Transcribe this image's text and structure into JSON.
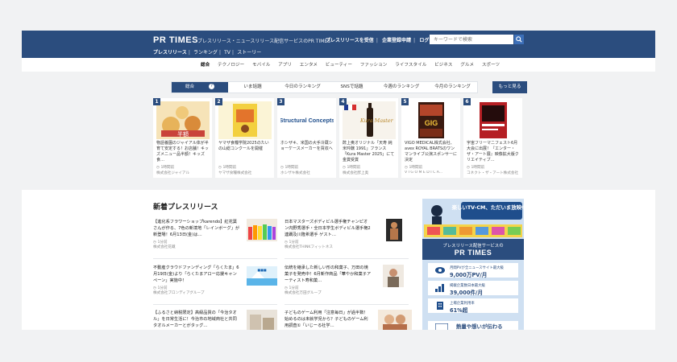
{
  "header": {
    "logo": "PR TIMES",
    "tagline": "プレスリリース・ニュースリリース配信サービスのPR TIMES",
    "links": [
      "プレスリリースを受信",
      "企業登録申請",
      "ログイン"
    ],
    "search_placeholder": "キーワードで検索",
    "subnav": [
      "プレスリリース",
      "ランキング",
      "TV",
      "ストーリー"
    ]
  },
  "category_nav": [
    "総合",
    "テクノロジー",
    "モバイル",
    "アプリ",
    "エンタメ",
    "ビューティー",
    "ファッション",
    "ライフスタイル",
    "ビジネス",
    "グルメ",
    "スポーツ"
  ],
  "ranking": {
    "tabs": [
      {
        "label": "総合",
        "badge": "?"
      },
      {
        "label": "いま話題"
      },
      {
        "label": "今日のランキング"
      },
      {
        "label": "SNSで話題"
      },
      {
        "label": "今週のランキング"
      },
      {
        "label": "今月のランキング"
      }
    ],
    "more_label": "もっと見る",
    "cards": [
      {
        "rank": "1",
        "thumb_text": "半額",
        "title": "物語養園のジャイアル体が半育て安定する！お店舗！キッズメニュー品半額！キッズ食…",
        "time": "1時間前",
        "company": "株式会社ジャイアル"
      },
      {
        "rank": "2",
        "thumb_text": "",
        "title": "ヤマザ食糧学院2025のたいの山総コンクールを開催",
        "time": "1時間前",
        "company": "ヤマザ食糧株式会社"
      },
      {
        "rank": "3",
        "thumb_text": "Structural Concepts",
        "title": "ホシザキ、米国の大手冷蔵ショーケースメーカーを買収へ",
        "time": "1時間前",
        "company": "ホシザキ株式会社"
      },
      {
        "rank": "4",
        "thumb_text": "Kura Master",
        "title": "酢上奥オリジナル「天寿 純米吟醸 1991」フランス「Kura Master 2025」にて金賞受賞",
        "time": "1時間前",
        "company": "株式会社酢上奥"
      },
      {
        "rank": "5",
        "thumb_text": "GIG",
        "title": "VIGO MEDICAL株式会社、avex ROYAL BRATSのワンマンライブ公演スポンサーに決定",
        "time": "1時間前",
        "company": "V I G O M E D I C A..."
      },
      {
        "rank": "6",
        "thumb_text": "",
        "title": "宇宙フリーマニフェスト6月大会に出展！『エンター・ザ・アート展』映像拡大版クリエイティブ…",
        "time": "1時間前",
        "company": "コネクト・ザ・アート株式会社"
      }
    ]
  },
  "new_releases": {
    "title": "新着プレスリリース",
    "items": [
      {
        "title": "【進化系フラワーショップkarendo】紅花葉さんが作る、7色の新境地「レインボーグ」が新登場！6月13日(金)は…",
        "time": "1分前",
        "company": "株式会社花蔵"
      },
      {
        "title": "日本マスターズボディビル選手権チャンピオン内野秀選手・全日本学生ボディビル選手権2連覇及川隆希選手 ゲスト…",
        "time": "1分前",
        "company": "株式会社THINKフィットネス"
      },
      {
        "title": "不動産クラウドファンディング「らくたま」6月19日(金)より「らくたまアロー応援キャンペーン」実施中！",
        "time": "1分前",
        "company": "株式会社ブロンディアグループ"
      },
      {
        "title": "伝統を継承した新しい形の和菓子、万田の焼菓子を発売中！6月新作商品「華やか和菓子アーティスト寿和菓…",
        "time": "1分前",
        "company": "株式会社万田グループ"
      },
      {
        "title": "【ふるさと納税限定】高級品質の「今治タオル」を日常生活に！今治市の地域商社と共同タオルメーカーとがタッグ…",
        "time": "1分前",
        "company": "株式会社ゆう"
      },
      {
        "title": "子どものゲーム利用「注意毎日」が過半数！始めるのは未就学児から？子どものゲーム利用調査①「いじーる社学…",
        "time": "1分前",
        "company": "株式会社いじーる"
      }
    ]
  },
  "ad": {
    "headline": "楽しいTV-CM、ただいま放映中!!",
    "service_label": "プレスリリース配信サービスの",
    "brand": "PR TIMES",
    "stats": [
      {
        "label": "月間PVが全ニュースサイト最大級",
        "value": "9,000万PV/月"
      },
      {
        "label": "掲載企業数日本最大級",
        "value": "39,000件/月"
      },
      {
        "label": "上場企業利用率",
        "value": "61%超"
      }
    ],
    "bottom_text": "熱量や想いが伝わる"
  }
}
